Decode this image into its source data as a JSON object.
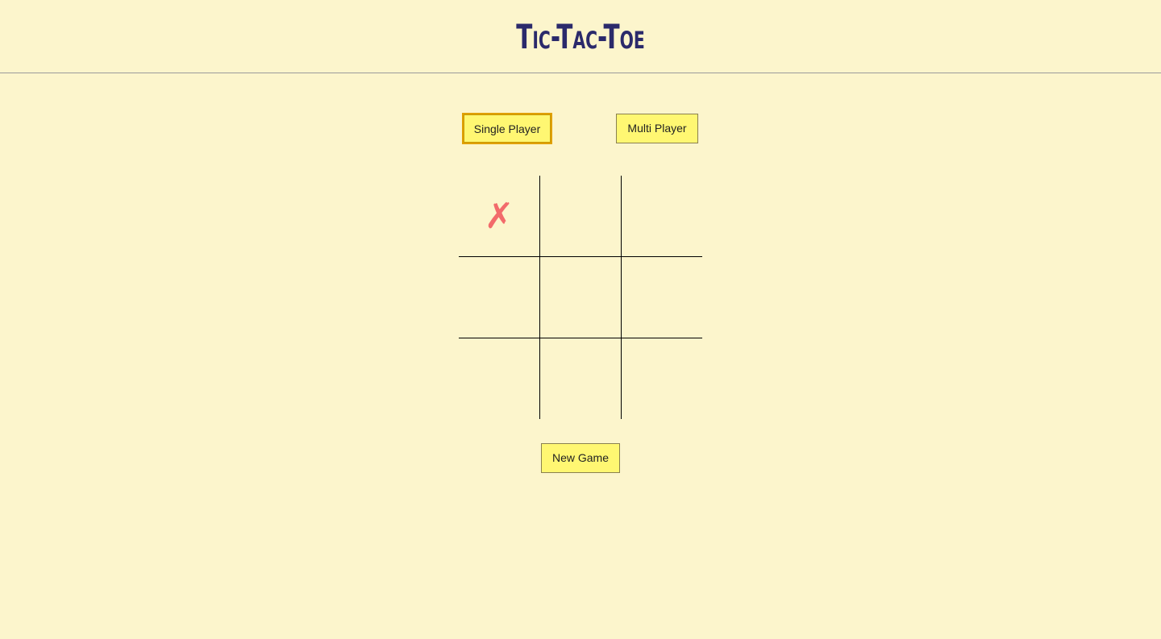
{
  "header": {
    "title": "Tic-Tac-Toe"
  },
  "mode_buttons": {
    "single": "Single Player",
    "multi": "Multi Player",
    "selected": "Single Player"
  },
  "board": {
    "cells": [
      [
        "✗",
        "",
        ""
      ],
      [
        "",
        "",
        ""
      ],
      [
        "",
        "",
        ""
      ]
    ],
    "x_color": "#f26b6b"
  },
  "controls": {
    "new_game": "New Game"
  },
  "colors": {
    "background": "#fcf5cc",
    "title": "#2b2a6b",
    "button": "#fff772"
  }
}
